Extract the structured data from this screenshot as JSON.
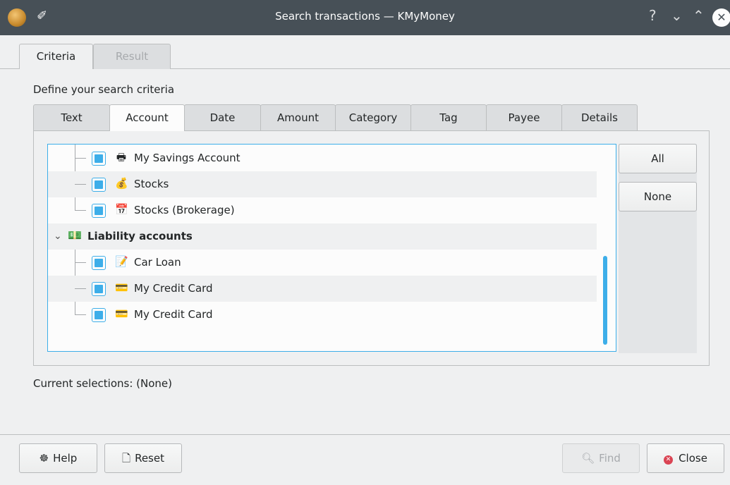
{
  "window": {
    "title": "Search transactions — KMyMoney",
    "help_glyph": "?",
    "minimize_glyph": "⌄",
    "maximize_glyph": "⌃",
    "close_glyph": "✕"
  },
  "outer_tabs": [
    {
      "label": "Criteria",
      "active": true
    },
    {
      "label": "Result",
      "active": false
    }
  ],
  "define_label": "Define your search criteria",
  "inner_tabs": [
    {
      "label": "Text"
    },
    {
      "label": "Account",
      "active": true
    },
    {
      "label": "Date"
    },
    {
      "label": "Amount"
    },
    {
      "label": "Category"
    },
    {
      "label": "Tag"
    },
    {
      "label": "Payee"
    },
    {
      "label": "Details"
    }
  ],
  "tree": {
    "rows": [
      {
        "label": "My Savings Account",
        "checked": true,
        "icon": "savings-icon"
      },
      {
        "label": "Stocks",
        "checked": true,
        "icon": "stocks-icon"
      },
      {
        "label": "Stocks (Brokerage)",
        "checked": true,
        "icon": "brokerage-icon"
      },
      {
        "label": "Liability accounts",
        "group": true,
        "icon": "liability-icon",
        "expander": "⌄"
      },
      {
        "label": "Car Loan",
        "checked": true,
        "icon": "loan-icon"
      },
      {
        "label": "My Credit Card",
        "checked": true,
        "icon": "credit-card-icon"
      },
      {
        "label": "My Credit Card",
        "checked": true,
        "icon": "credit-card-icon"
      }
    ]
  },
  "buttons": {
    "all": "All",
    "none": "None",
    "help": "Help",
    "reset": "Reset",
    "find": "Find",
    "close": "Close"
  },
  "current_selections": "Current selections: (None)",
  "colors": {
    "accent": "#3daee9",
    "titlebar": "#475057",
    "close_red": "#da4453"
  }
}
